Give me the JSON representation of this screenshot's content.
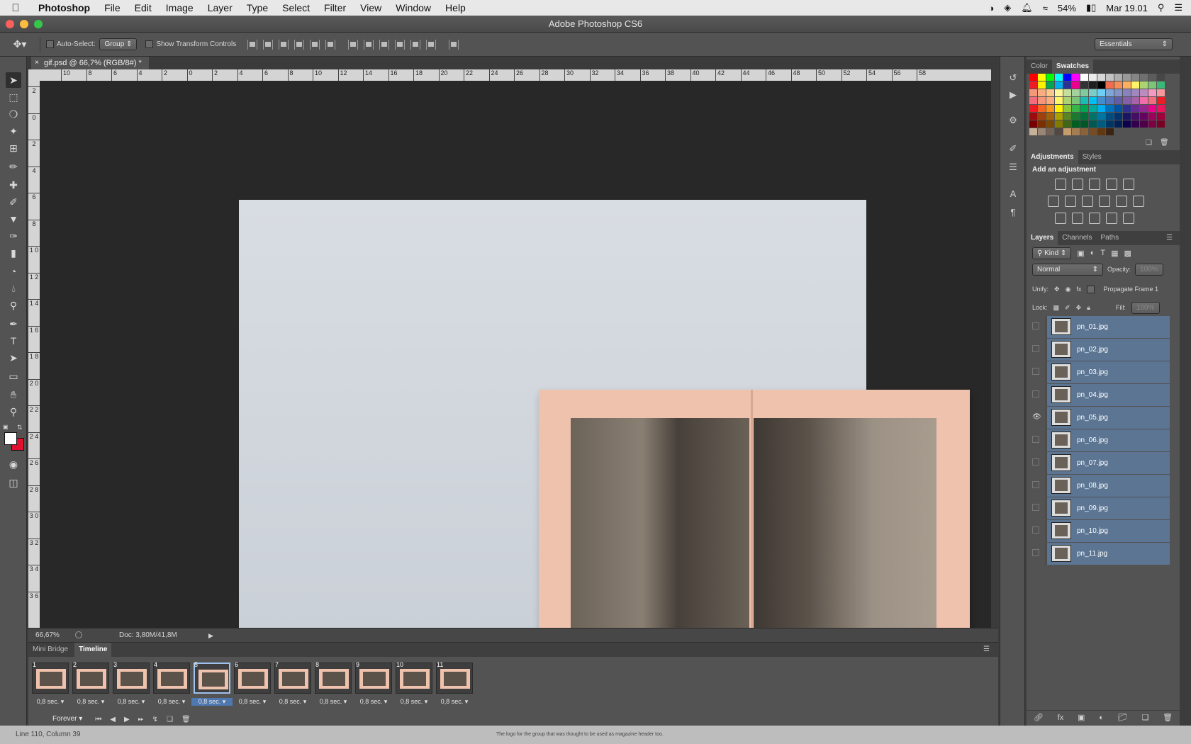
{
  "menubar": {
    "app": "Photoshop",
    "items": [
      "File",
      "Edit",
      "Image",
      "Layer",
      "Type",
      "Select",
      "Filter",
      "View",
      "Window",
      "Help"
    ],
    "battery": "54%",
    "date": "Mar 19.01"
  },
  "window": {
    "title": "Adobe Photoshop CS6"
  },
  "options": {
    "auto_select_label": "Auto-Select:",
    "auto_select_value": "Group",
    "show_transform_label": "Show Transform Controls",
    "workspace": "Essentials"
  },
  "document": {
    "tab_title": "gif.psd @ 66,7% (RGB/8#) *",
    "ruler_h": [
      "10",
      "8",
      "6",
      "4",
      "2",
      "0",
      "2",
      "4",
      "6",
      "8",
      "10",
      "12",
      "14",
      "16",
      "18",
      "20",
      "22",
      "24",
      "26",
      "28",
      "30",
      "32",
      "34",
      "36",
      "38",
      "40",
      "42",
      "44",
      "46",
      "48",
      "50",
      "52",
      "54",
      "56",
      "58"
    ],
    "ruler_v": [
      "2",
      "0",
      "2",
      "4",
      "6",
      "8",
      "1 0",
      "1 2",
      "1 4",
      "1 6",
      "1 8",
      "2 0",
      "2 2",
      "2 4",
      "2 6",
      "2 8",
      "3 0",
      "3 2",
      "3 4",
      "3 6"
    ],
    "zoom": "66,67%",
    "doc_size": "Doc: 3,80M/41,8M"
  },
  "timeline": {
    "tabs": [
      "Mini Bridge",
      "Timeline"
    ],
    "active_tab": "Timeline",
    "frames": [
      {
        "num": "1",
        "delay": "0,8 sec."
      },
      {
        "num": "2",
        "delay": "0,8 sec."
      },
      {
        "num": "3",
        "delay": "0,8 sec."
      },
      {
        "num": "4",
        "delay": "0,8 sec."
      },
      {
        "num": "5",
        "delay": "0,8 sec."
      },
      {
        "num": "6",
        "delay": "0,8 sec."
      },
      {
        "num": "7",
        "delay": "0,8 sec."
      },
      {
        "num": "8",
        "delay": "0,8 sec."
      },
      {
        "num": "9",
        "delay": "0,8 sec."
      },
      {
        "num": "10",
        "delay": "0,8 sec."
      },
      {
        "num": "11",
        "delay": "0,8 sec."
      }
    ],
    "selected_frame": 5,
    "loop": "Forever"
  },
  "panels": {
    "color_tabs": [
      "Color",
      "Swatches"
    ],
    "adjust_tabs": [
      "Adjustments",
      "Styles"
    ],
    "add_adjustment": "Add an adjustment",
    "layer_tabs": [
      "Layers",
      "Channels",
      "Paths"
    ],
    "kind": "Kind",
    "blend_mode": "Normal",
    "opacity_label": "Opacity:",
    "opacity_value": "100%",
    "unify_label": "Unify:",
    "propagate_label": "Propagate Frame 1",
    "lock_label": "Lock:",
    "fill_label": "Fill:",
    "fill_value": "100%",
    "layers": [
      {
        "name": "pn_01.jpg",
        "visible": false
      },
      {
        "name": "pn_02.jpg",
        "visible": false
      },
      {
        "name": "pn_03.jpg",
        "visible": false
      },
      {
        "name": "pn_04.jpg",
        "visible": false
      },
      {
        "name": "pn_05.jpg",
        "visible": true
      },
      {
        "name": "pn_06.jpg",
        "visible": false
      },
      {
        "name": "pn_07.jpg",
        "visible": false
      },
      {
        "name": "pn_08.jpg",
        "visible": false
      },
      {
        "name": "pn_09.jpg",
        "visible": false
      },
      {
        "name": "pn_10.jpg",
        "visible": false
      },
      {
        "name": "pn_11.jpg",
        "visible": false
      }
    ]
  },
  "bottom": {
    "left_text": "Line 110, Column 39",
    "center_text": "The logo for the group that was thought to be used as magazine header too."
  },
  "colors": {
    "accent_selection": "#5b7593",
    "foreground": "#ffffff",
    "background": "#e0102f"
  }
}
